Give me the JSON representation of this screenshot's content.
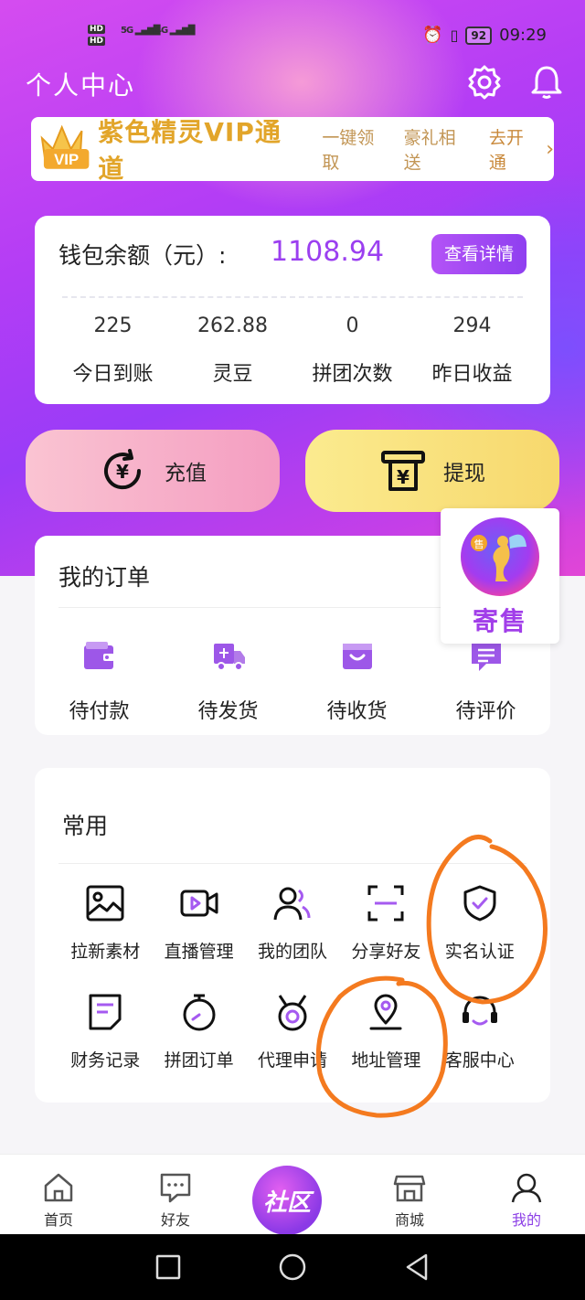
{
  "status_bar": {
    "time": "09:29",
    "battery": "92",
    "net1": "5G",
    "net2": "4G"
  },
  "header": {
    "title": "个人中心"
  },
  "vip_banner": {
    "badge": "VIP",
    "title": "紫色精灵VIP通道",
    "desc1": "一键领取",
    "desc2": "豪礼相送",
    "action": "去开通"
  },
  "wallet": {
    "label": "钱包余额（元）:",
    "amount": "1108.94",
    "detail_button": "查看详情",
    "stats": [
      {
        "value": "225",
        "label": "今日到账"
      },
      {
        "value": "262.88",
        "label": "灵豆"
      },
      {
        "value": "0",
        "label": "拼团次数"
      },
      {
        "value": "294",
        "label": "昨日收益"
      }
    ]
  },
  "actions": {
    "recharge": "充值",
    "withdraw": "提现"
  },
  "consign": {
    "label": "寄售",
    "tag": "售"
  },
  "orders": {
    "title": "我的订单",
    "items": [
      {
        "label": "待付款",
        "icon": "wallet-icon"
      },
      {
        "label": "待发货",
        "icon": "truck-icon"
      },
      {
        "label": "待收货",
        "icon": "box-icon"
      },
      {
        "label": "待评价",
        "icon": "comment-icon"
      }
    ]
  },
  "common": {
    "title": "常用",
    "items": [
      {
        "label": "拉新素材",
        "icon": "image-icon"
      },
      {
        "label": "直播管理",
        "icon": "video-icon"
      },
      {
        "label": "我的团队",
        "icon": "team-icon"
      },
      {
        "label": "分享好友",
        "icon": "scan-icon"
      },
      {
        "label": "实名认证",
        "icon": "shield-check-icon"
      },
      {
        "label": "财务记录",
        "icon": "document-icon"
      },
      {
        "label": "拼团订单",
        "icon": "timer-icon"
      },
      {
        "label": "代理申请",
        "icon": "medal-icon"
      },
      {
        "label": "地址管理",
        "icon": "location-icon"
      },
      {
        "label": "客服中心",
        "icon": "headset-icon"
      }
    ]
  },
  "tabbar": {
    "items": [
      {
        "label": "首页",
        "icon": "home-icon"
      },
      {
        "label": "好友",
        "icon": "chat-icon"
      },
      {
        "label": "社区",
        "icon": "community-icon"
      },
      {
        "label": "商城",
        "icon": "store-icon"
      },
      {
        "label": "我的",
        "icon": "profile-icon"
      }
    ],
    "active": "我的"
  },
  "colors": {
    "accent": "#9b3ff0",
    "vip_gold": "#e2a52a",
    "annotation": "#f47a1f"
  }
}
